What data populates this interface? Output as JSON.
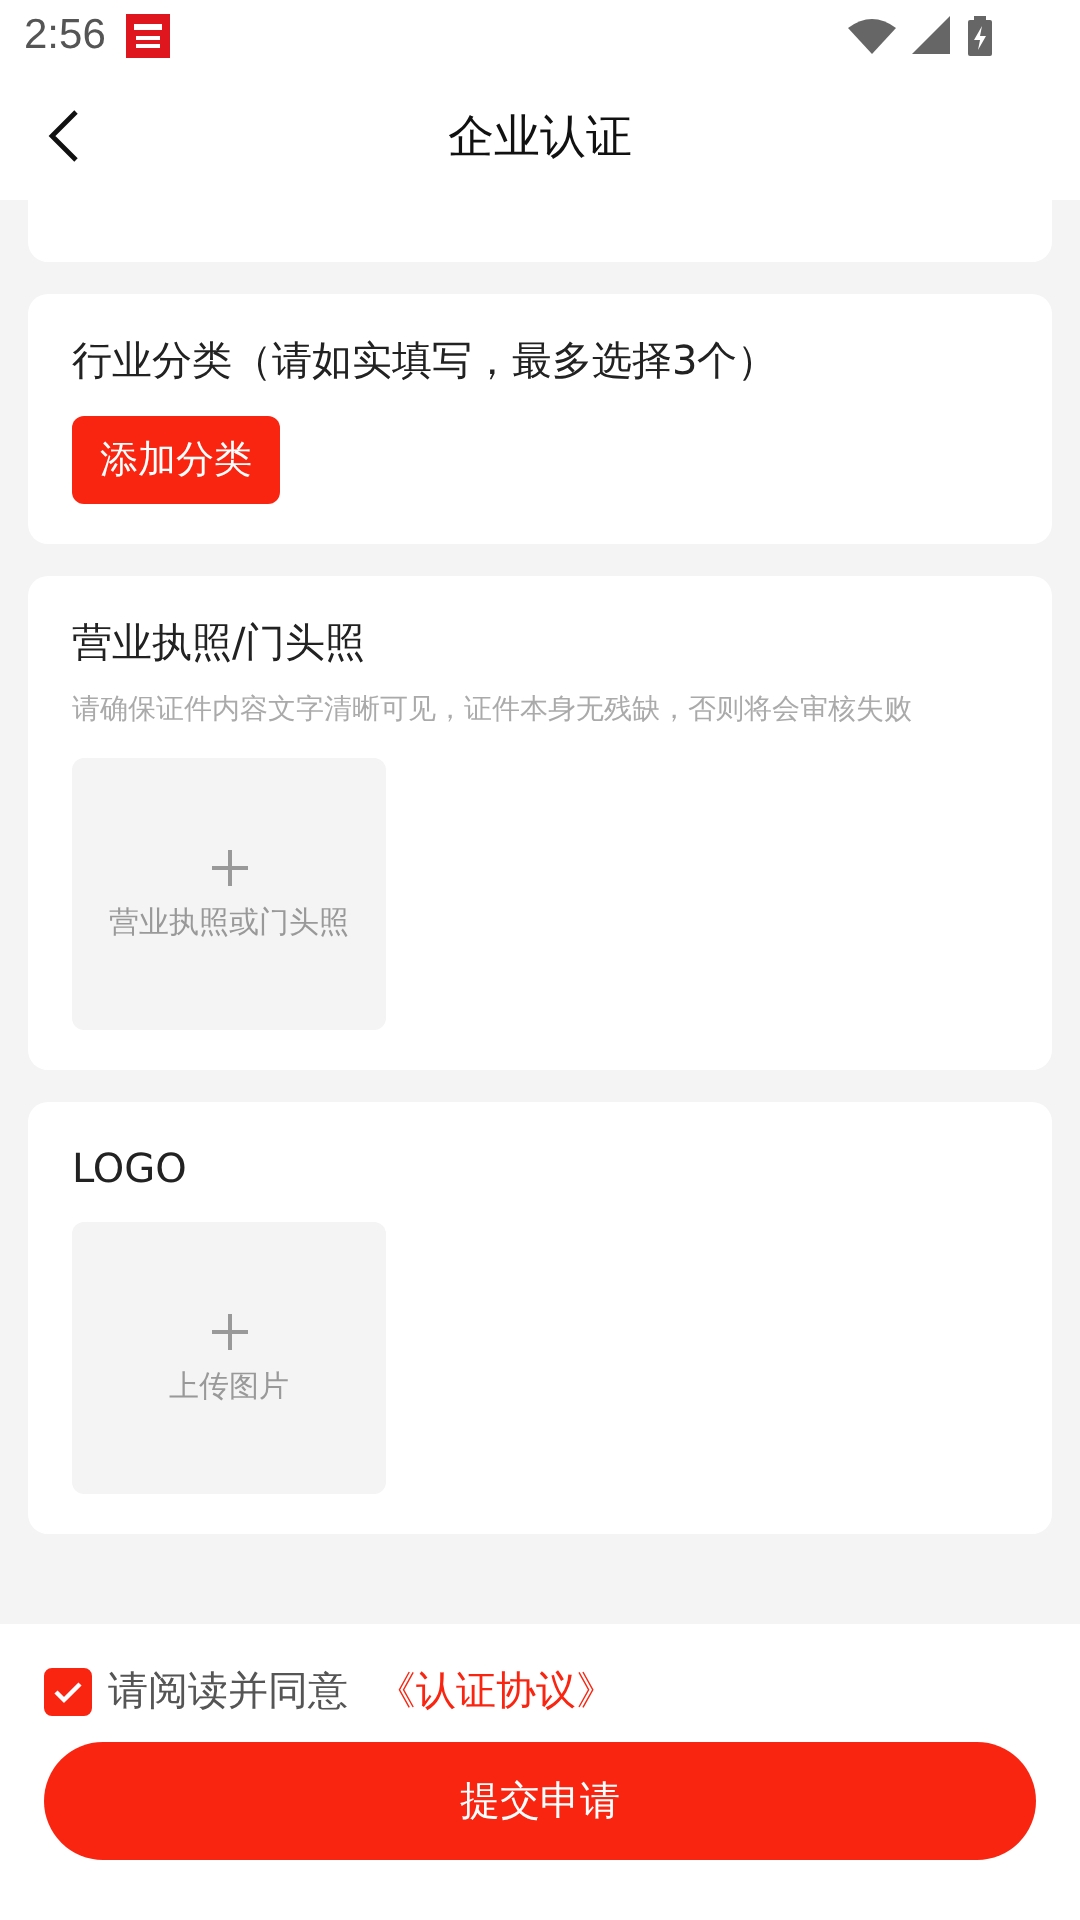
{
  "status_bar": {
    "time": "2:56"
  },
  "header": {
    "title": "企业认证"
  },
  "sections": [
    {
      "kind": "partial"
    },
    {
      "kind": "category",
      "title": "行业分类（请如实填写，最多选择3个）",
      "button": "添加分类"
    },
    {
      "kind": "upload",
      "title": "营业执照/门头照",
      "hint": "请确保证件内容文字清晰可见，证件本身无残缺，否则将会审核失败",
      "upload_label": "营业执照或门头照"
    },
    {
      "kind": "upload",
      "title": "LOGO",
      "upload_label": "上传图片"
    }
  ],
  "agreement": {
    "checked": true,
    "text": "请阅读并同意",
    "link": "《认证协议》"
  },
  "submit_button": "提交申请"
}
